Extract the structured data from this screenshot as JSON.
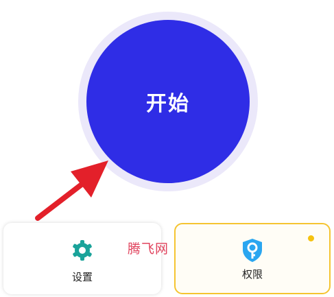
{
  "start_button": {
    "label": "开始"
  },
  "cards": {
    "settings": {
      "label": "设置",
      "icon": "gear-icon",
      "icon_color": "#1aa39a"
    },
    "permissions": {
      "label": "权限",
      "icon": "key-shield-icon",
      "icon_color": "#2aa6f0",
      "border_color": "#f5c431",
      "has_notification": true
    }
  },
  "watermark": {
    "text": "腾飞网"
  },
  "colors": {
    "primary": "#2f2de6",
    "ring": "#ebe8fa",
    "arrow": "#e3202a",
    "accent_yellow": "#f5c20f"
  }
}
